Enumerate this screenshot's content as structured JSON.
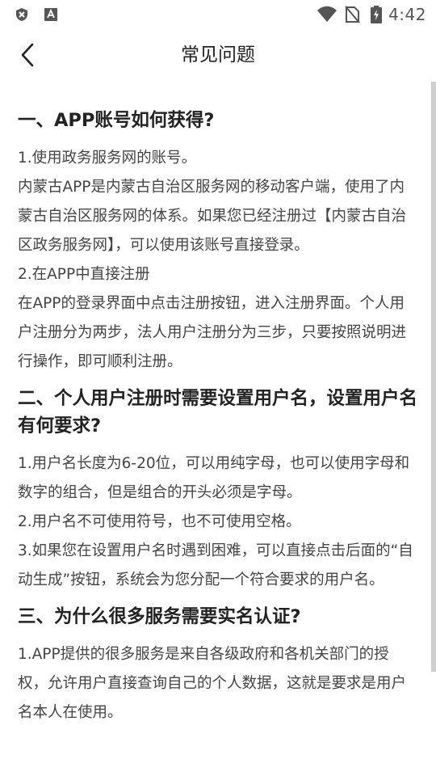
{
  "status_bar": {
    "time": "4:42",
    "left_icons": [
      "shield-icon",
      "a-icon"
    ],
    "right_icons": [
      "wifi-icon",
      "no-sim-icon",
      "battery-charging-icon"
    ]
  },
  "nav": {
    "back_icon": "chevron-left-icon",
    "title": "常见问题"
  },
  "sections": [
    {
      "title": "一、APP账号如何获得?",
      "paragraphs": [
        "1.使用政务服务网的账号。",
        "内蒙古APP是内蒙古自治区服务网的移动客户端，使用了内蒙古自治区服务网的体系。如果您已经注册过【内蒙古自治区政务服务网】，可以使用该账号直接登录。",
        "2.在APP中直接注册",
        "在APP的登录界面中点击注册按钮，进入注册界面。个人用户注册分为两步，法人用户注册分为三步，只要按照说明进行操作，即可顺利注册。"
      ]
    },
    {
      "title": "二、个人用户注册时需要设置用户名，设置用户名有何要求?",
      "paragraphs": [
        "1.用户名长度为6-20位，可以用纯字母，也可以使用字母和数字的组合，但是组合的开头必须是字母。",
        "2.用户名不可使用符号，也不可使用空格。",
        "3.如果您在设置用户名时遇到困难，可以直接点击后面的“自动生成”按钮，系统会为您分配一个符合要求的用户名。"
      ]
    },
    {
      "title": "三、为什么很多服务需要实名认证?",
      "paragraphs": [
        "1.APP提供的很多服务是来自各级政府和各机关部门的授权，允许用户直接查询自己的个人数据，这就是要求是用户名本人在使用。"
      ]
    }
  ]
}
